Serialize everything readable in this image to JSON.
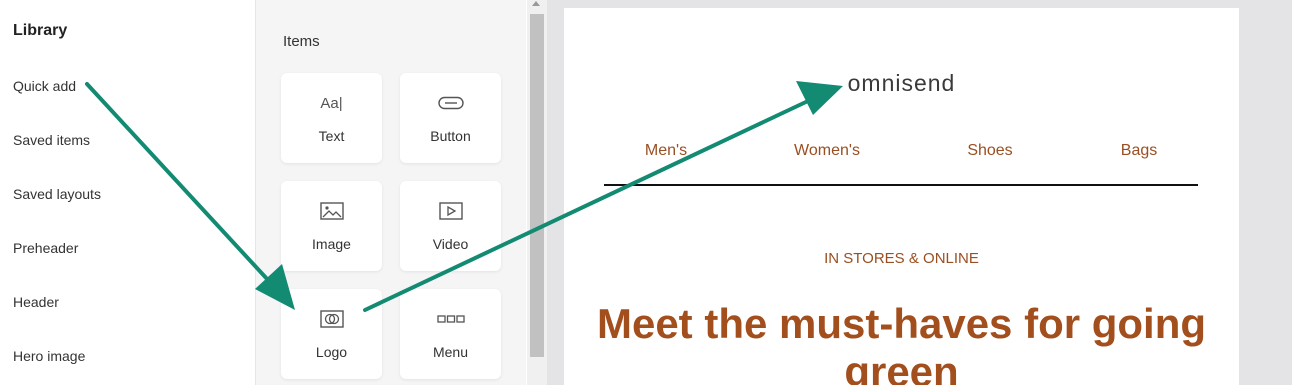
{
  "library": {
    "title": "Library",
    "items": [
      "Quick add",
      "Saved items",
      "Saved layouts",
      "Preheader",
      "Header",
      "Hero image"
    ]
  },
  "items_panel": {
    "title": "Items",
    "cards": [
      {
        "label": "Text",
        "icon": "text-icon",
        "glyph": "Aa|"
      },
      {
        "label": "Button",
        "icon": "button-icon"
      },
      {
        "label": "Image",
        "icon": "image-icon"
      },
      {
        "label": "Video",
        "icon": "video-icon"
      },
      {
        "label": "Logo",
        "icon": "logo-icon"
      },
      {
        "label": "Menu",
        "icon": "menu-icon"
      }
    ]
  },
  "email": {
    "logo_text": "omnisend",
    "menu": [
      "Men's",
      "Women's",
      "Shoes",
      "Bags"
    ],
    "eyebrow": "IN STORES & ONLINE",
    "headline": "Meet the must-haves for going green"
  },
  "colors": {
    "accent_text": "#9a4f22",
    "headline": "#a24f1d",
    "annotation_arrow": "#138a72",
    "canvas_bg": "#e4e4e7"
  }
}
